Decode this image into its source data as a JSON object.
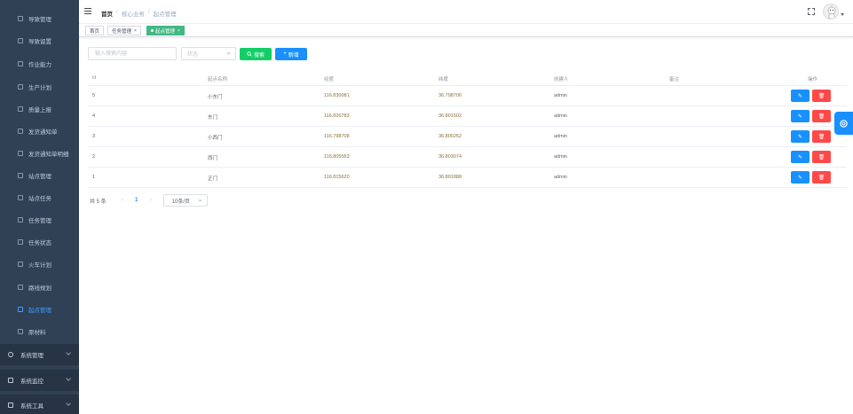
{
  "sidebar": {
    "items": [
      {
        "label": "导致管理"
      },
      {
        "label": "导致留置"
      },
      {
        "label": "作业能力"
      },
      {
        "label": "生产计划"
      },
      {
        "label": "质量上报"
      },
      {
        "label": "发货通知单"
      },
      {
        "label": "发货通知单明细"
      },
      {
        "label": "站点管理"
      },
      {
        "label": "站点任务"
      },
      {
        "label": "任务管理"
      },
      {
        "label": "任务状态"
      },
      {
        "label": "火车计划"
      },
      {
        "label": "路线规划"
      },
      {
        "label": "起点管理"
      },
      {
        "label": "原材料"
      }
    ],
    "groups": [
      {
        "label": "系统管理"
      },
      {
        "label": "系统监控"
      },
      {
        "label": "系统工具"
      }
    ]
  },
  "header": {
    "breadcrumb": [
      "首页",
      "核心业务",
      "起点管理"
    ]
  },
  "tags": [
    {
      "label": "首页"
    },
    {
      "label": "任务管理"
    },
    {
      "label": "起点管理"
    }
  ],
  "toolbar": {
    "search_placeholder": "输入搜索内容",
    "status_placeholder": "状态",
    "search_label": "搜索",
    "add_label": "新增"
  },
  "table": {
    "columns": [
      "id",
      "起点名称",
      "经度",
      "纬度",
      "创建人",
      "备注",
      "操作"
    ],
    "rows": [
      {
        "id": "5",
        "name": "小东门",
        "lng": "116.830081",
        "lat": "36.798706",
        "creator": "admin",
        "remark": ""
      },
      {
        "id": "4",
        "name": "东门",
        "lng": "116.826783",
        "lat": "36.801502",
        "creator": "admin",
        "remark": ""
      },
      {
        "id": "3",
        "name": "小西门",
        "lng": "116.798708",
        "lat": "36.800252",
        "creator": "admin",
        "remark": ""
      },
      {
        "id": "2",
        "name": "西门",
        "lng": "116.805553",
        "lat": "36.803074",
        "creator": "admin",
        "remark": ""
      },
      {
        "id": "1",
        "name": "正门",
        "lng": "116.815620",
        "lat": "36.801888",
        "creator": "admin",
        "remark": ""
      }
    ]
  },
  "pagination": {
    "total_text": "共 5 条",
    "current_page": "1",
    "page_size": "10条/页"
  },
  "colors": {
    "sidebar_bg": "#304156",
    "active": "#409eff",
    "tag_active": "#42b983",
    "search_btn": "#13ce66",
    "primary": "#1890ff",
    "danger": "#ff4949"
  }
}
